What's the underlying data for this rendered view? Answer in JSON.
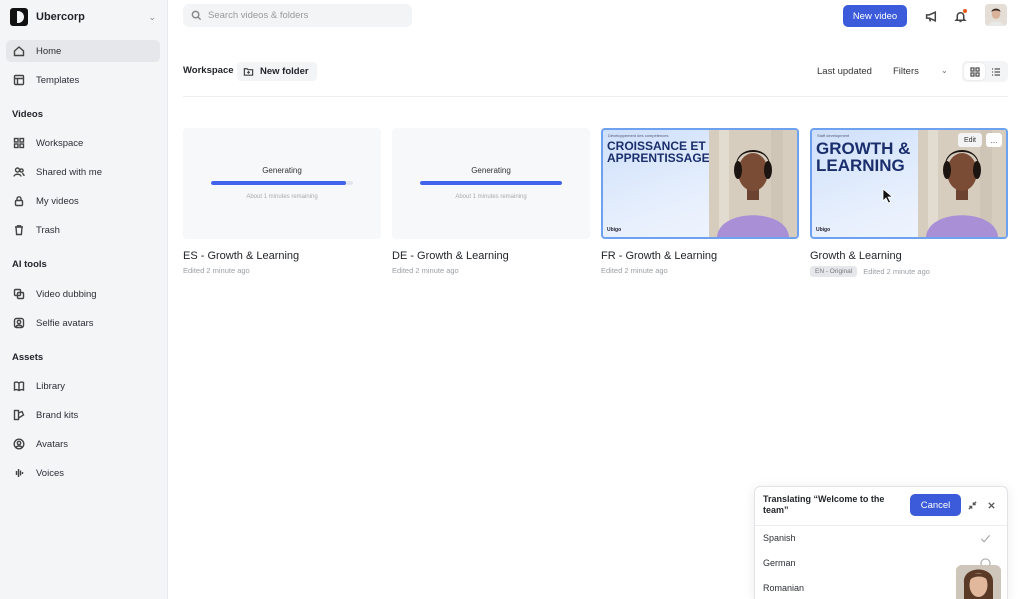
{
  "org": {
    "name": "Ubercorp"
  },
  "sidebar": {
    "top_items": [
      {
        "label": "Home",
        "icon": "home-icon"
      },
      {
        "label": "Templates",
        "icon": "templates-icon"
      }
    ],
    "sections": [
      {
        "title": "Videos",
        "items": [
          {
            "label": "Workspace",
            "icon": "grid-icon"
          },
          {
            "label": "Shared with me",
            "icon": "users-icon"
          },
          {
            "label": "My videos",
            "icon": "lock-icon"
          },
          {
            "label": "Trash",
            "icon": "trash-icon"
          }
        ]
      },
      {
        "title": "AI tools",
        "items": [
          {
            "label": "Video dubbing",
            "icon": "dubbing-icon"
          },
          {
            "label": "Selfie avatars",
            "icon": "selfie-icon"
          }
        ]
      },
      {
        "title": "Assets",
        "items": [
          {
            "label": "Library",
            "icon": "book-icon"
          },
          {
            "label": "Brand kits",
            "icon": "brand-icon"
          },
          {
            "label": "Avatars",
            "icon": "avatar-icon"
          },
          {
            "label": "Voices",
            "icon": "waveform-icon"
          }
        ]
      }
    ]
  },
  "header": {
    "search_placeholder": "Search videos & folders",
    "new_video_label": "New video"
  },
  "toolbar": {
    "breadcrumb": "Workspace",
    "new_folder_label": "New folder",
    "sort_label": "Last updated",
    "filters_label": "Filters"
  },
  "cards": [
    {
      "title": "ES - Growth & Learning",
      "meta": "Edited 2 minute ago",
      "status": "Generating",
      "progress": 0.95,
      "progress_text": "About 1 minutes remaining"
    },
    {
      "title": "DE - Growth & Learning",
      "meta": "Edited 2 minute ago",
      "status": "Generating",
      "progress": 1.0,
      "progress_text": "About 1 minutes remaining"
    },
    {
      "title": "FR - Growth & Learning",
      "meta": "Edited 2 minute ago",
      "thumb_small": "Développement des compétences",
      "thumb_headline": "CROISSANCE ET APPRENTISSAGE",
      "thumb_logo": "Ubigo"
    },
    {
      "title": "Growth & Learning",
      "meta": "Edited 2 minute ago",
      "badge": "EN - Original",
      "thumb_small": "Staff development",
      "thumb_headline": "GROWTH & LEARNING",
      "thumb_logo": "Ubigo",
      "edit_label": "Edit",
      "more_label": "..."
    }
  ],
  "translate_panel": {
    "title": "Translating “Welcome to the team”",
    "cancel_label": "Cancel",
    "languages": [
      {
        "name": "Spanish",
        "state": "done"
      },
      {
        "name": "German",
        "state": "pending"
      },
      {
        "name": "Romanian",
        "state": "pending"
      }
    ]
  },
  "colors": {
    "accent": "#3b5bdb",
    "progress": "#4263eb",
    "sidebar_bg": "#f4f5f7",
    "thumb_border": "#6ea2f0"
  }
}
